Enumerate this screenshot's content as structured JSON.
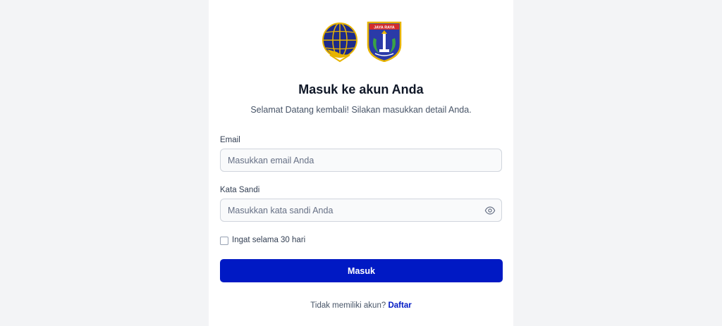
{
  "logos": {
    "primary": "kemenhub-logo",
    "secondary": "jakarta-logo"
  },
  "header": {
    "title": "Masuk ke akun Anda",
    "subtitle": "Selamat Datang kembali! Silakan masukkan detail Anda."
  },
  "form": {
    "email_label": "Email",
    "email_placeholder": "Masukkan email Anda",
    "email_value": "",
    "password_label": "Kata Sandi",
    "password_placeholder": "Masukkan kata sandi Anda",
    "password_value": "",
    "remember_label": "Ingat selama 30 hari",
    "remember_checked": false,
    "submit_label": "Masuk"
  },
  "footer": {
    "prompt": "Tidak memiliki akun?",
    "signup_link": "Daftar"
  },
  "colors": {
    "primary": "#0019c4",
    "background": "#f3f4f6",
    "card": "#ffffff"
  }
}
